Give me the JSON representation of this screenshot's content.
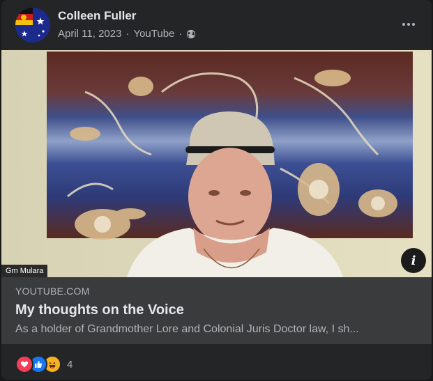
{
  "post": {
    "author": "Colleen Fuller",
    "date": "April 11, 2023",
    "source": "YouTube",
    "separator": "·",
    "privacy_icon": "globe-icon",
    "more_icon": "ellipsis-icon"
  },
  "media": {
    "video_label": "Gm Mulara",
    "info_icon": "info-icon"
  },
  "link": {
    "domain": "YOUTUBE.COM",
    "title": "My thoughts on the Voice",
    "description": "As a holder of Grandmother Lore and Colonial Juris Doctor law, I sh..."
  },
  "reactions": {
    "types": [
      "love-icon",
      "like-icon",
      "haha-icon"
    ],
    "count": "4"
  },
  "colors": {
    "background": "#242526",
    "link_box": "#3a3b3c",
    "text_primary": "#e4e6eb",
    "text_secondary": "#b0b3b8",
    "love": "#f33e58",
    "like": "#1877f2",
    "haha": "#f7b125"
  }
}
